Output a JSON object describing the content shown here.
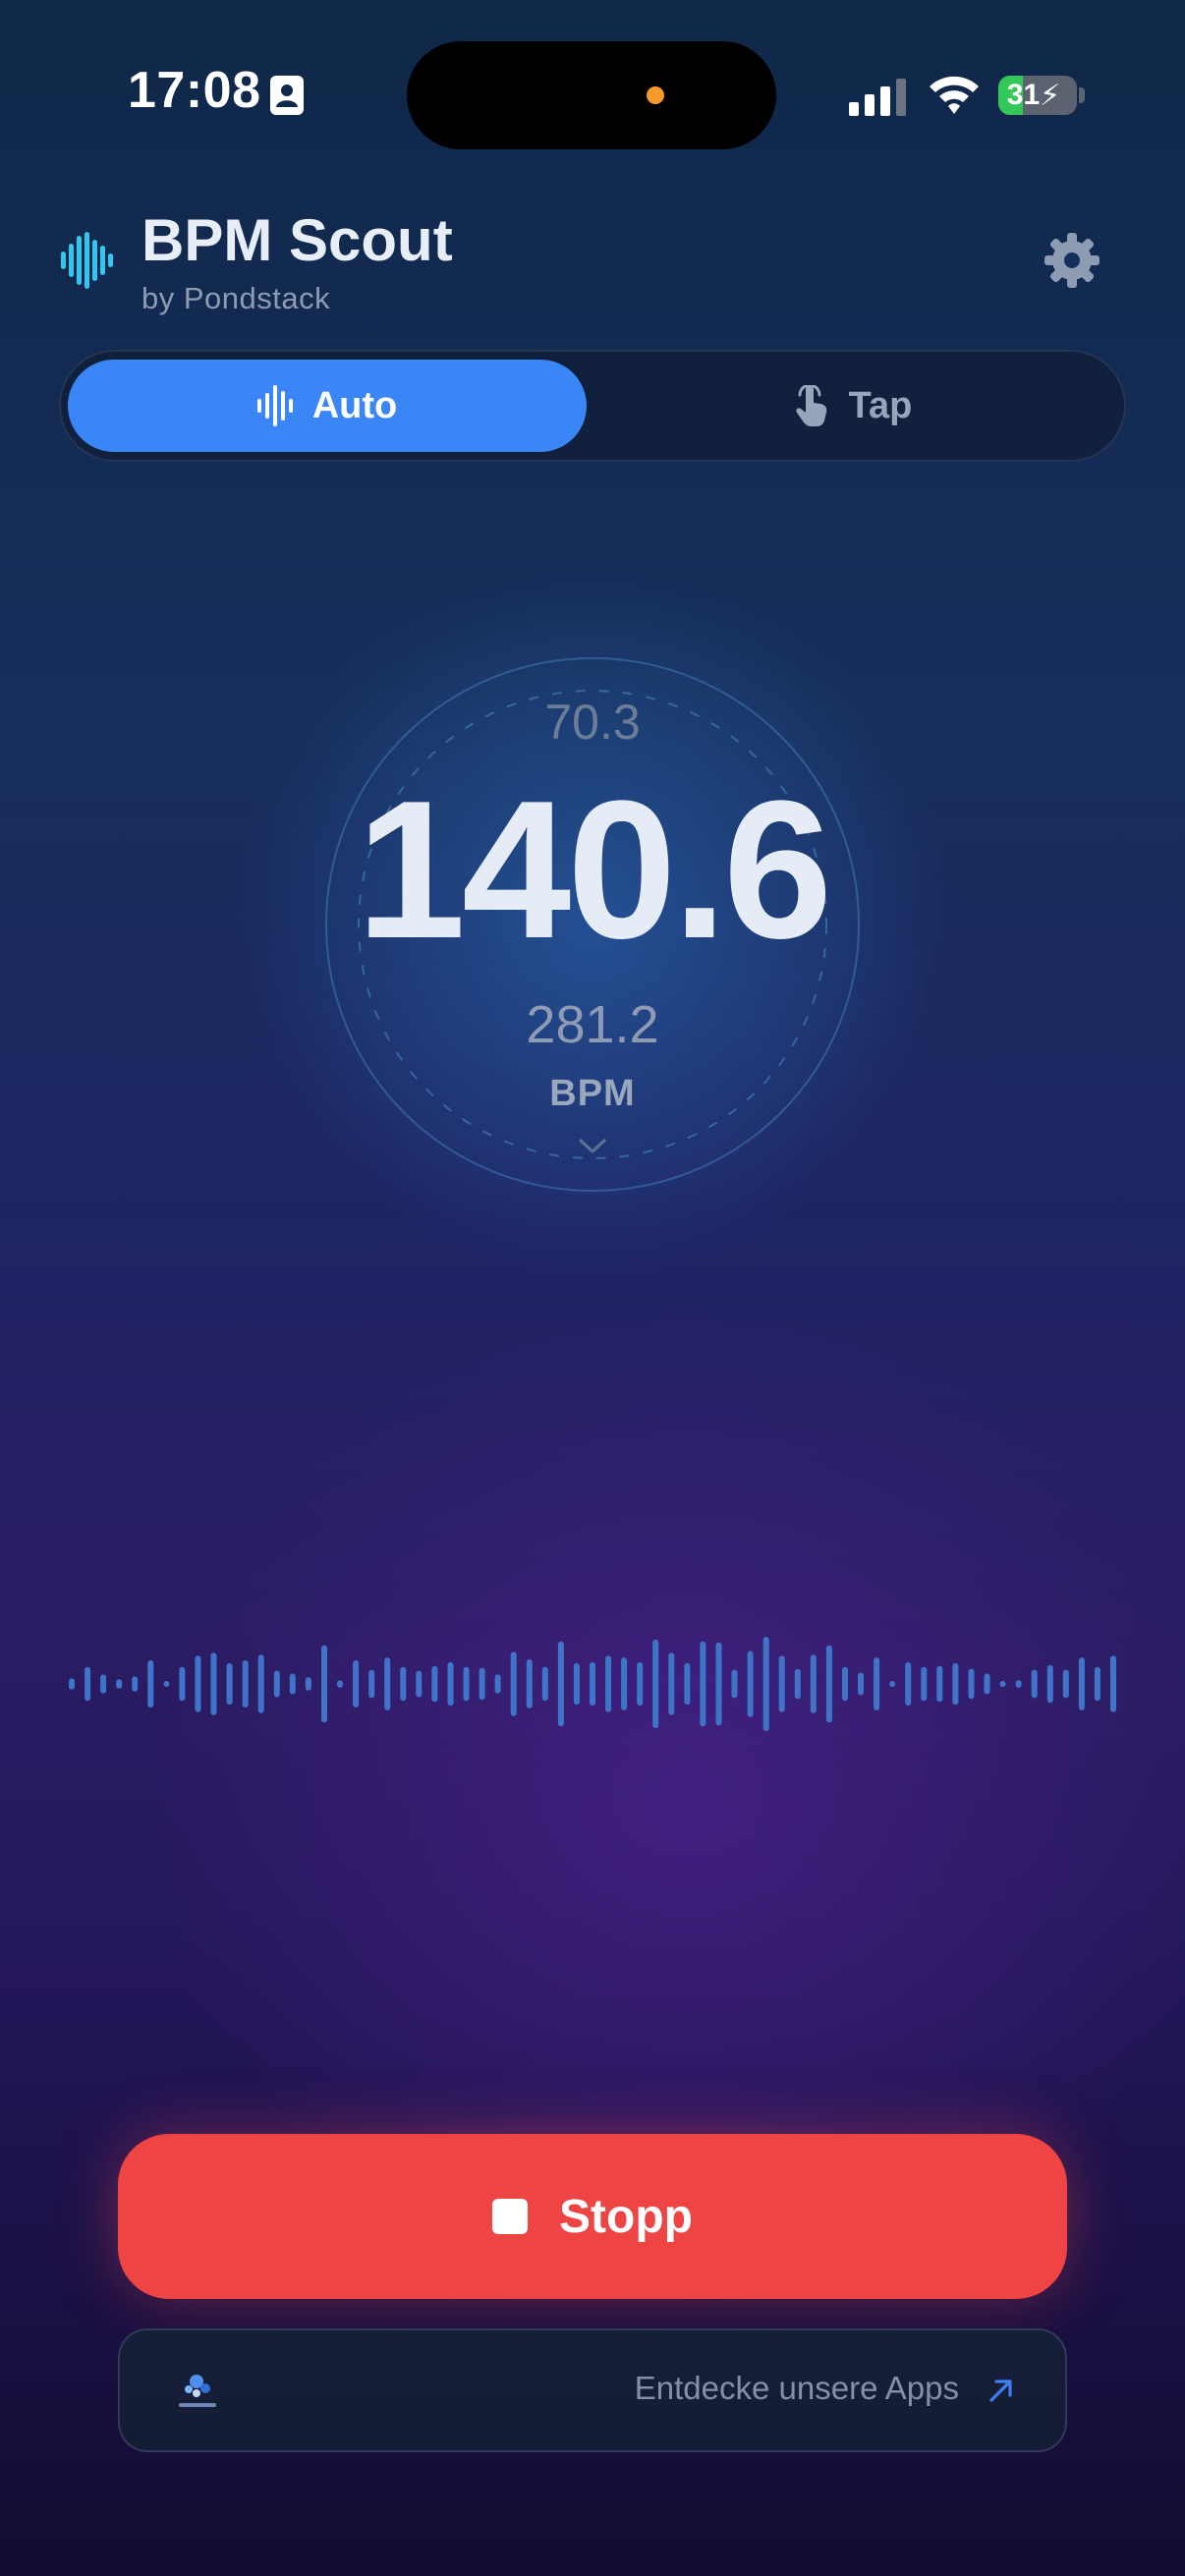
{
  "status_bar": {
    "time": "17:08",
    "battery_percent": "31",
    "battery_level": 0.31,
    "icons": [
      "contact-card-icon",
      "cellular-signal-icon",
      "wifi-icon",
      "battery-charging-icon"
    ]
  },
  "header": {
    "title": "BPM Scout",
    "subtitle": "by Pondstack",
    "logo_icon": "waveform-icon",
    "settings_icon": "gear-icon"
  },
  "mode_tabs": [
    {
      "label": "Auto",
      "icon": "waveform-icon",
      "selected": true
    },
    {
      "label": "Tap",
      "icon": "tap-hand-icon",
      "selected": false
    }
  ],
  "bpm": {
    "half": "70.3",
    "main": "140.6",
    "double": "281.2",
    "unit": "BPM"
  },
  "waveform": {
    "amplitudes": [
      0.12,
      0.36,
      0.2,
      0.1,
      0.16,
      0.5,
      0.06,
      0.36,
      0.6,
      0.66,
      0.44,
      0.5,
      0.62,
      0.28,
      0.22,
      0.14,
      0.82,
      0.08,
      0.5,
      0.3,
      0.56,
      0.36,
      0.28,
      0.38,
      0.46,
      0.36,
      0.34,
      0.2,
      0.68,
      0.52,
      0.36,
      0.9,
      0.44,
      0.46,
      0.6,
      0.56,
      0.46,
      0.94,
      0.66,
      0.44,
      0.9,
      0.88,
      0.3,
      0.7,
      1.0,
      0.6,
      0.32,
      0.62,
      0.82,
      0.36,
      0.24,
      0.56,
      0.06,
      0.46,
      0.36,
      0.38,
      0.44,
      0.32,
      0.22,
      0.06,
      0.08,
      0.3,
      0.4,
      0.3,
      0.56,
      0.36,
      0.6
    ]
  },
  "stop_button": {
    "label": "Stopp"
  },
  "apps_banner": {
    "label": "Entdecke unsere Apps"
  },
  "colors": {
    "accent": "#3b86f6",
    "stop": "#ef4444",
    "waveform": "#3f74c9",
    "logo": "#34c6ee"
  }
}
